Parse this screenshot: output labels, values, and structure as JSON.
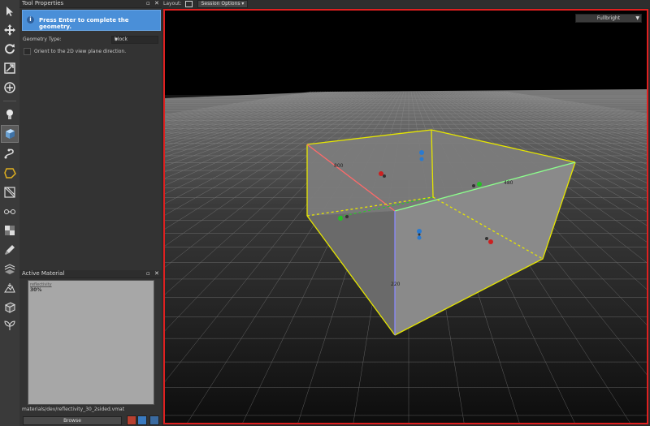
{
  "tool_properties": {
    "title": "Tool Properties",
    "info_message": "Press Enter to complete the geometry.",
    "geometry_type_label": "Geometry Type:",
    "geometry_type_value": "block",
    "orient_label": "Orient to the 2D view plane direction."
  },
  "active_material": {
    "title": "Active Material",
    "preview_name": "reflectivity",
    "preview_value": "30%",
    "path": "materials/dev/reflectivity_30_2sided.vmat",
    "browse_label": "Browse"
  },
  "topbar": {
    "layout_label": "Layout:",
    "session_options_label": "Session Options"
  },
  "viewport": {
    "render_mode": "Fullbright",
    "dim_top_left": "800",
    "dim_right": "480",
    "dim_front": "220"
  },
  "toolbar_icons": [
    "select-icon",
    "move-icon",
    "rotate-icon",
    "scale-icon",
    "pivot-icon",
    "light-icon",
    "block-icon",
    "path-icon",
    "polygon-icon",
    "clip-icon",
    "texture-icon",
    "material-icon",
    "paint-icon",
    "displacement-icon",
    "terrain-icon",
    "mesh-icon",
    "foliage-icon"
  ],
  "colors": {
    "accent_blue": "#4a8fd8",
    "viewport_border": "#e02020",
    "selection_yellow": "#e6e600"
  }
}
